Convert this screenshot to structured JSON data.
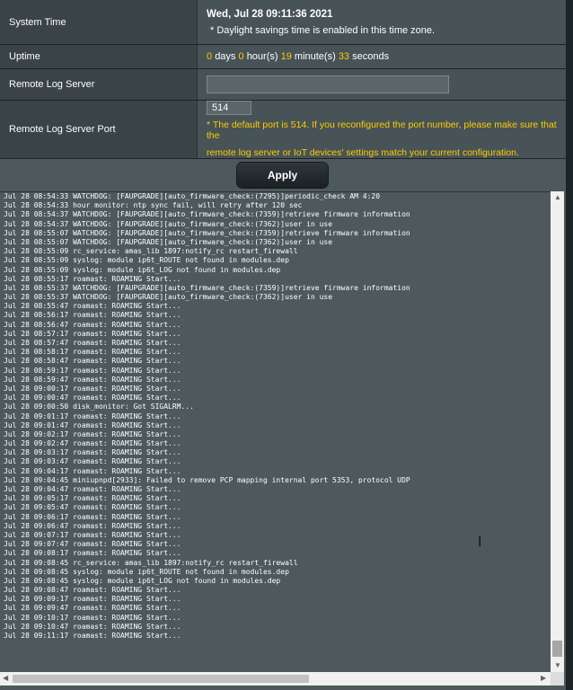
{
  "settings": {
    "system_time": {
      "label": "System Time",
      "value": "Wed, Jul 28 09:11:36 2021",
      "note": "* Daylight savings time is enabled in this time zone."
    },
    "uptime": {
      "label": "Uptime",
      "days": "0",
      "days_unit": "days",
      "hours": "0",
      "hours_unit": "hour(s)",
      "minutes": "19",
      "minutes_unit": "minute(s)",
      "seconds": "33",
      "seconds_unit": "seconds"
    },
    "remote_log_server": {
      "label": "Remote Log Server",
      "value": ""
    },
    "remote_log_server_port": {
      "label": "Remote Log Server Port",
      "value": "514",
      "note_line1": "* The default port is 514. If you reconfigured the port number, please make sure that the",
      "note_line2": "remote log server or IoT devices' settings match your current configuration."
    }
  },
  "apply_label": "Apply",
  "log_lines": [
    "Jul 28 08:54:33 WATCHDOG: [FAUPGRADE][auto_firmware_check:(7295)]periodic_check AM 4:20",
    "Jul 28 08:54:33 hour monitor: ntp sync fail, will retry after 120 sec",
    "Jul 28 08:54:37 WATCHDOG: [FAUPGRADE][auto_firmware_check:(7359)]retrieve firmware information",
    "Jul 28 08:54:37 WATCHDOG: [FAUPGRADE][auto_firmware_check:(7362)]user in use",
    "Jul 28 08:55:07 WATCHDOG: [FAUPGRADE][auto_firmware_check:(7359)]retrieve firmware information",
    "Jul 28 08:55:07 WATCHDOG: [FAUPGRADE][auto_firmware_check:(7362)]user in use",
    "Jul 28 08:55:09 rc_service: amas_lib 1897:notify_rc restart_firewall",
    "Jul 28 08:55:09 syslog: module ip6t_ROUTE not found in modules.dep",
    "Jul 28 08:55:09 syslog: module ip6t_LOG not found in modules.dep",
    "Jul 28 08:55:17 roamast: ROAMING Start...",
    "Jul 28 08:55:37 WATCHDOG: [FAUPGRADE][auto_firmware_check:(7359)]retrieve firmware information",
    "Jul 28 08:55:37 WATCHDOG: [FAUPGRADE][auto_firmware_check:(7362)]user in use",
    "Jul 28 08:55:47 roamast: ROAMING Start...",
    "Jul 28 08:56:17 roamast: ROAMING Start...",
    "Jul 28 08:56:47 roamast: ROAMING Start...",
    "Jul 28 08:57:17 roamast: ROAMING Start...",
    "Jul 28 08:57:47 roamast: ROAMING Start...",
    "Jul 28 08:58:17 roamast: ROAMING Start...",
    "Jul 28 08:58:47 roamast: ROAMING Start...",
    "Jul 28 08:59:17 roamast: ROAMING Start...",
    "Jul 28 08:59:47 roamast: ROAMING Start...",
    "Jul 28 09:00:17 roamast: ROAMING Start...",
    "Jul 28 09:00:47 roamast: ROAMING Start...",
    "Jul 28 09:00:50 disk_monitor: Got SIGALRM...",
    "Jul 28 09:01:17 roamast: ROAMING Start...",
    "Jul 28 09:01:47 roamast: ROAMING Start...",
    "Jul 28 09:02:17 roamast: ROAMING Start...",
    "Jul 28 09:02:47 roamast: ROAMING Start...",
    "Jul 28 09:03:17 roamast: ROAMING Start...",
    "Jul 28 09:03:47 roamast: ROAMING Start...",
    "Jul 28 09:04:17 roamast: ROAMING Start...",
    "Jul 28 09:04:45 miniupnpd[2933]: Failed to remove PCP mapping internal port 5353, protocol UDP",
    "Jul 28 09:04:47 roamast: ROAMING Start...",
    "Jul 28 09:05:17 roamast: ROAMING Start...",
    "Jul 28 09:05:47 roamast: ROAMING Start...",
    "Jul 28 09:06:17 roamast: ROAMING Start...",
    "Jul 28 09:06:47 roamast: ROAMING Start...",
    "Jul 28 09:07:17 roamast: ROAMING Start...",
    "Jul 28 09:07:47 roamast: ROAMING Start...",
    "Jul 28 09:08:17 roamast: ROAMING Start...",
    "Jul 28 09:08:45 rc_service: amas_lib 1897:notify_rc restart_firewall",
    "Jul 28 09:08:45 syslog: module ip6t_ROUTE not found in modules.dep",
    "Jul 28 09:08:45 syslog: module ip6t_LOG not found in modules.dep",
    "Jul 28 09:08:47 roamast: ROAMING Start...",
    "Jul 28 09:09:17 roamast: ROAMING Start...",
    "Jul 28 09:09:47 roamast: ROAMING Start...",
    "Jul 28 09:10:17 roamast: ROAMING Start...",
    "Jul 28 09:10:47 roamast: ROAMING Start...",
    "Jul 28 09:11:17 roamast: ROAMING Start..."
  ],
  "scroll_arrows": {
    "up": "▲",
    "down": "▼",
    "left": "◀",
    "right": "▶"
  },
  "cursor_glyph": "I",
  "colors": {
    "panel_bg": "#4d595d",
    "label_bg": "#3a4347",
    "value_bg": "#475357",
    "highlight": "#ffcc00"
  }
}
